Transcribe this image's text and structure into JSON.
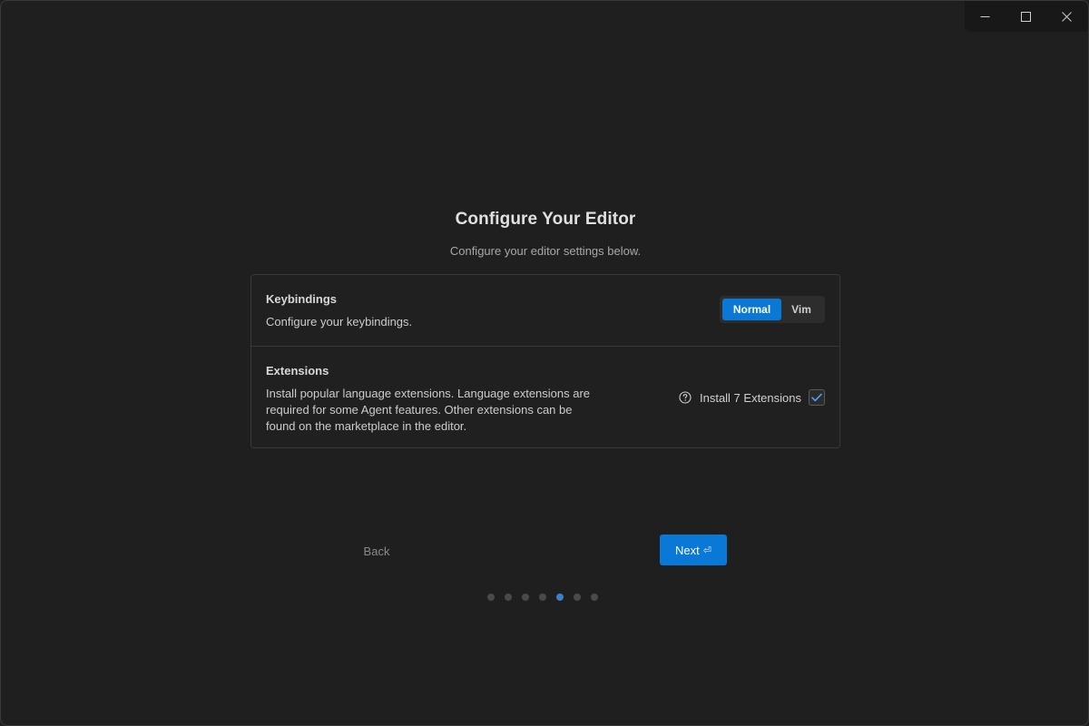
{
  "window": {
    "controls": [
      {
        "name": "minimize-icon"
      },
      {
        "name": "maximize-icon"
      },
      {
        "name": "close-icon"
      }
    ]
  },
  "page": {
    "title": "Configure Your Editor",
    "subtitle": "Configure your editor settings below."
  },
  "keybindings": {
    "title": "Keybindings",
    "description": "Configure your keybindings.",
    "options": [
      "Normal",
      "Vim"
    ],
    "selected": "Normal"
  },
  "extensions": {
    "title": "Extensions",
    "description": "Install popular language extensions. Language extensions are required for some Agent features. Other extensions can be found on the marketplace in the editor.",
    "install_label": "Install 7 Extensions",
    "checked": true
  },
  "nav": {
    "back_label": "Back",
    "next_label": "Next",
    "next_glyph": "⏎"
  },
  "progress": {
    "total_steps": 7,
    "current_step": 5
  },
  "colors": {
    "accent": "#0a78d7",
    "background": "#1f1f1f",
    "active_dot": "#3b82c4"
  }
}
